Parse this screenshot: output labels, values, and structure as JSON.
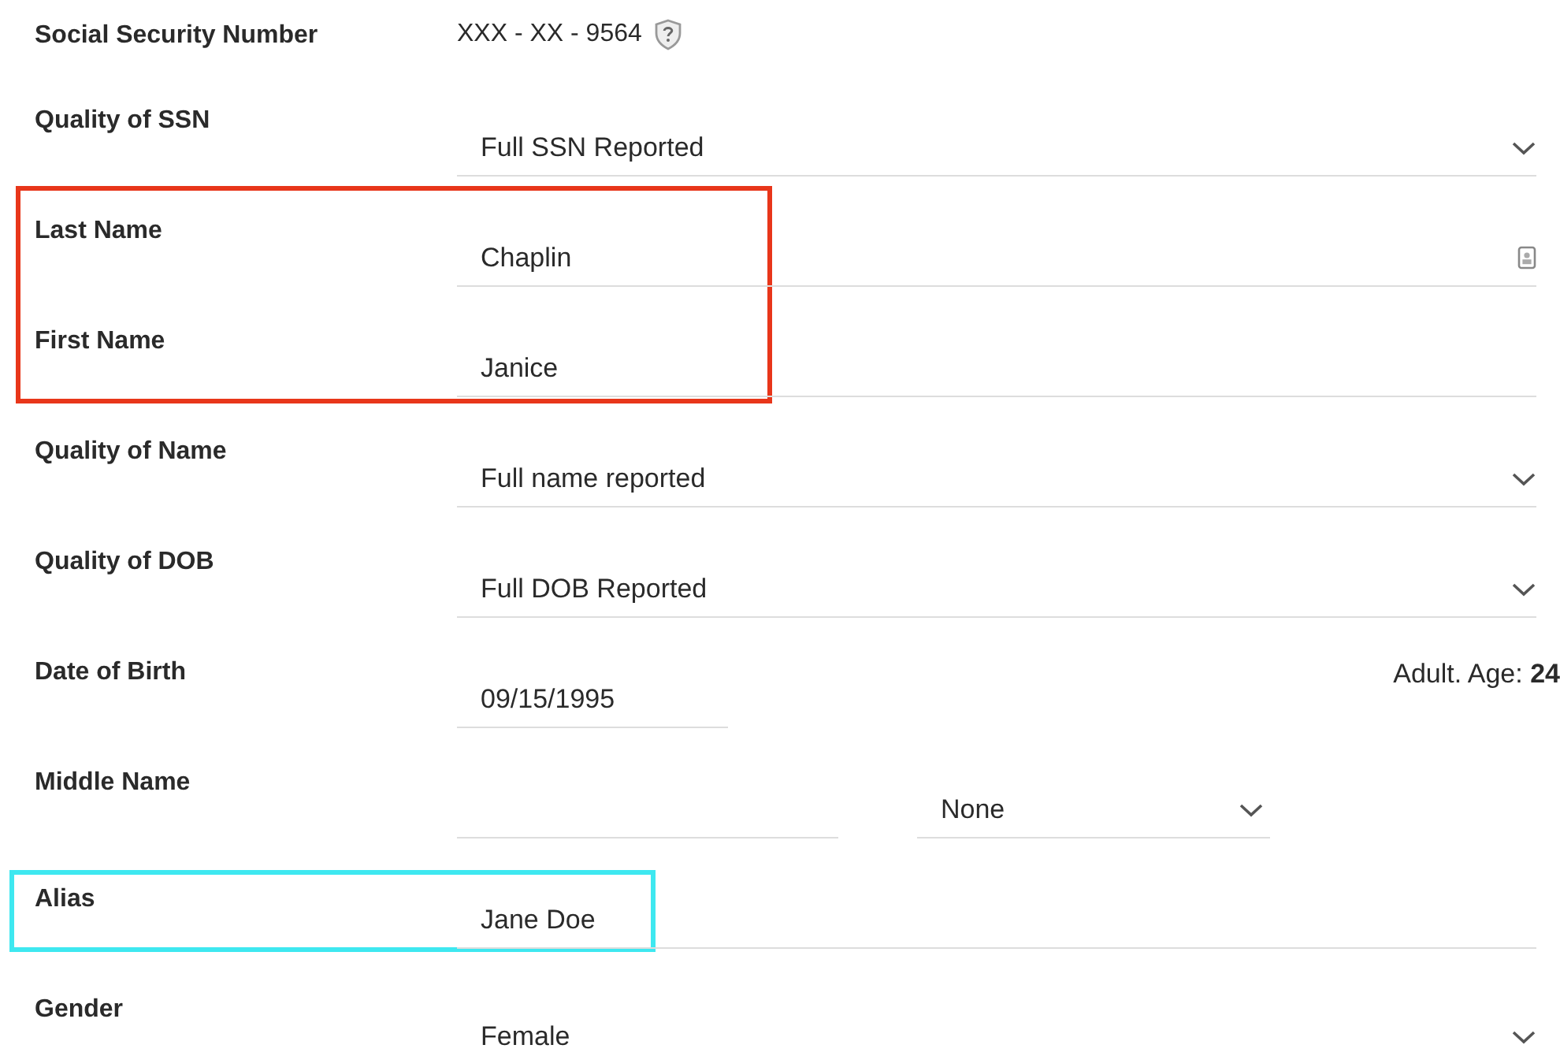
{
  "groups": [
    {
      "rows": [
        {
          "label": "Social Security Number",
          "kind": "static",
          "value": "XXX - XX - 9564",
          "help_icon": true
        },
        {
          "label": "Quality of SSN",
          "kind": "select",
          "value": "Full SSN Reported"
        }
      ]
    },
    {
      "color": "#e8361a",
      "rows": [
        {
          "label": "Last Name",
          "kind": "text",
          "value": "Chaplin",
          "contact_icon": true
        },
        {
          "label": "First Name",
          "kind": "text",
          "value": "Janice"
        }
      ]
    },
    {
      "rows": [
        {
          "label": "Quality of Name",
          "kind": "select",
          "value": "Full name reported"
        },
        {
          "label": "Quality of DOB",
          "kind": "select",
          "value": "Full DOB Reported"
        },
        {
          "label": "Date of Birth",
          "kind": "date",
          "value": "09/15/1995",
          "age_label": "Adult. Age:",
          "age": "24"
        },
        {
          "label": "Middle Name",
          "kind": "split",
          "option": "None"
        }
      ]
    },
    {
      "color": "#3ee8f0",
      "rows": [
        {
          "label": "Alias",
          "kind": "text",
          "value": "Jane Doe"
        }
      ]
    },
    {
      "rows": [
        {
          "label": "Gender",
          "kind": "select",
          "value": "Female"
        }
      ]
    }
  ]
}
